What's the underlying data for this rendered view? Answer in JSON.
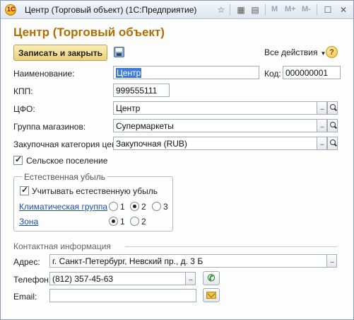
{
  "window": {
    "title": "Центр (Торговый объект)  (1С:Предприятие)",
    "logo_text": "1С",
    "toolbar": {
      "m": "M",
      "m_plus": "M+",
      "m_minus": "M-"
    }
  },
  "form": {
    "title": "Центр (Торговый объект)",
    "save_close_label": "Записать и закрыть",
    "all_actions_label": "Все действия",
    "help_label": "?"
  },
  "fields": {
    "name": {
      "label": "Наименование:",
      "value": "Центр"
    },
    "code": {
      "label": "Код:",
      "value": "000000001"
    },
    "kpp": {
      "label": "КПП:",
      "value": "999555111"
    },
    "cfo": {
      "label": "ЦФО:",
      "value": "Центр"
    },
    "store_group": {
      "label": "Группа магазинов:",
      "value": "Супермаркеты"
    },
    "purchase_category": {
      "label": "Закупочная категория цен:",
      "value": "Закупочная (RUB)"
    },
    "rural": {
      "label": "Сельское поселение",
      "checked": true
    }
  },
  "natural_loss": {
    "title": "Естественная убыль",
    "use_label": "Учитывать естественную убыль",
    "use_checked": true,
    "climate_label": "Климатическая группа",
    "climate_options": [
      "1",
      "2",
      "3"
    ],
    "climate_selected": "2",
    "zone_label": "Зона",
    "zone_options": [
      "1",
      "2"
    ],
    "zone_selected": "1"
  },
  "contact": {
    "title": "Контактная информация",
    "address_label": "Адрес:",
    "address_value": "г. Санкт-Петербург, Невский пр., д. 3 Б",
    "phone_label": "Телефон:",
    "phone_value": "(812) 357-45-63",
    "email_label": "Email:",
    "email_value": ""
  },
  "pick_glyph": "...",
  "colors": {
    "title": "#b06d00",
    "primary_button": "#ead07a",
    "link": "#1a4fa8",
    "selection": "#3d7bd4"
  }
}
